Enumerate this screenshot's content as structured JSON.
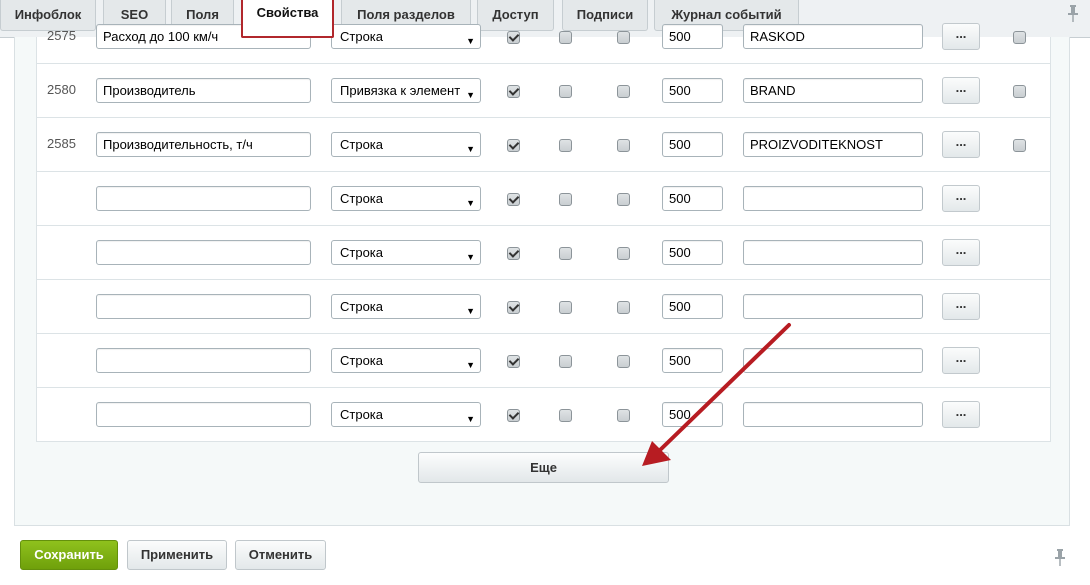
{
  "tabs": [
    {
      "label": "Инфоблок"
    },
    {
      "label": "SEO"
    },
    {
      "label": "Поля"
    },
    {
      "label": "Свойства"
    },
    {
      "label": "Поля разделов"
    },
    {
      "label": "Доступ"
    },
    {
      "label": "Подписи"
    },
    {
      "label": "Журнал событий"
    }
  ],
  "rows": [
    {
      "id": "2575",
      "name": "Расход до 100 км/ч",
      "type": "Строка",
      "sort": "500",
      "code": "RASKOD",
      "cut": true
    },
    {
      "id": "2580",
      "name": "Производитель",
      "type": "Привязка к элемент",
      "sort": "500",
      "code": "BRAND"
    },
    {
      "id": "2585",
      "name": "Производительность, т/ч",
      "type": "Строка",
      "sort": "500",
      "code": "PROIZVODITEKNOST"
    },
    {
      "id": "",
      "name": "",
      "type": "Строка",
      "sort": "500",
      "code": ""
    },
    {
      "id": "",
      "name": "",
      "type": "Строка",
      "sort": "500",
      "code": ""
    },
    {
      "id": "",
      "name": "",
      "type": "Строка",
      "sort": "500",
      "code": ""
    },
    {
      "id": "",
      "name": "",
      "type": "Строка",
      "sort": "500",
      "code": ""
    },
    {
      "id": "",
      "name": "",
      "type": "Строка",
      "sort": "500",
      "code": ""
    }
  ],
  "dots_label": "...",
  "more_label": "Еще",
  "buttons": {
    "save": "Сохранить",
    "apply": "Применить",
    "cancel": "Отменить"
  },
  "icons": {
    "pin": "pin-icon",
    "arrow": "red-pointer-arrow",
    "select_arrow": "▼"
  },
  "colors": {
    "active_tab_border": "#b1272c",
    "save_button": "#7cb013",
    "pointer_arrow": "#b71c22"
  }
}
